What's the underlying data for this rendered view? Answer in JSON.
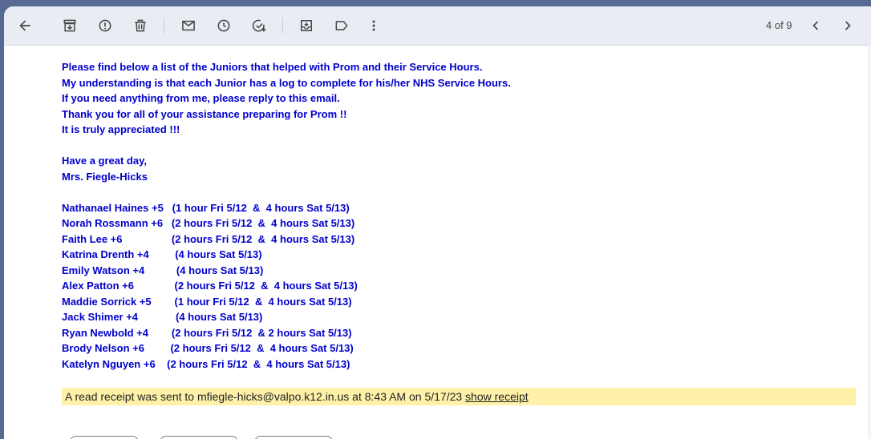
{
  "pager": {
    "label": "4 of 9"
  },
  "message": {
    "lines": [
      "Please find below a list of the Juniors that helped with Prom and their Service Hours.",
      "My understanding is that each Junior has a log to complete for his/her NHS Service Hours.",
      "If you need anything from me, please reply to this email.",
      "Thank you for all of your assistance preparing for Prom !!",
      "It is truly appreciated !!!",
      "",
      "Have a great day,",
      "Mrs. Fiegle-Hicks",
      "",
      "Nathanael Haines +5   (1 hour Fri 5/12  &  4 hours Sat 5/13)",
      "Norah Rossmann +6   (2 hours Fri 5/12  &  4 hours Sat 5/13)",
      "Faith Lee +6                 (2 hours Fri 5/12  &  4 hours Sat 5/13)",
      "Katrina Drenth +4         (4 hours Sat 5/13)",
      "Emily Watson +4           (4 hours Sat 5/13)",
      "Alex Patton +6              (2 hours Fri 5/12  &  4 hours Sat 5/13)",
      "Maddie Sorrick +5        (1 hour Fri 5/12  &  4 hours Sat 5/13)",
      "Jack Shimer +4             (4 hours Sat 5/13)",
      "Ryan Newbold +4        (2 hours Fri 5/12  & 2 hours Sat 5/13)",
      "Brody Nelson +6         (2 hours Fri 5/12  &  4 hours Sat 5/13)",
      "Katelyn Nguyen +6    (2 hours Fri 5/12  &  4 hours Sat 5/13)"
    ]
  },
  "receipt": {
    "text": "A read receipt was sent to mfiegle-hicks@valpo.k12.in.us at 8:43 AM on 5/17/23 ",
    "link": "show receipt"
  }
}
